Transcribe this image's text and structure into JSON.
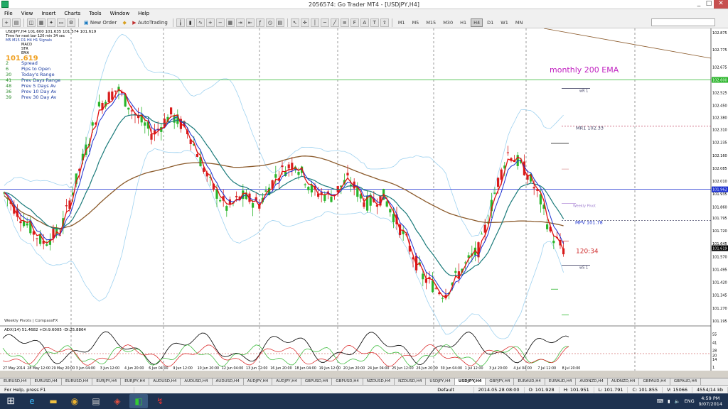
{
  "window": {
    "title": "2056574: Go Trader MT4 - [USDJPY,H4]",
    "min": "_",
    "max": "□",
    "close": "✕"
  },
  "menu": [
    "File",
    "View",
    "Insert",
    "Charts",
    "Tools",
    "Window",
    "Help"
  ],
  "toolbar": {
    "new_order": "New Order",
    "autotrading": "AutoTrading",
    "timeframes": [
      "M1",
      "M5",
      "M15",
      "M30",
      "H1",
      "H4",
      "D1",
      "W1",
      "MN"
    ],
    "active_tf": "H4"
  },
  "chart": {
    "header": "USDJPY,H4  101.600 101.635 101.574 101.619",
    "timer_note": "Time for next bar 120 min 34 sec",
    "tf_row": "M5  M15  D1  H4  H1  Signals",
    "indicators": [
      "MACD",
      "STR",
      "EMA"
    ],
    "big_price": "101.619",
    "stats": [
      {
        "n": "2",
        "l": "Spread"
      },
      {
        "n": "6",
        "l": "Pips to Open"
      },
      {
        "n": "30",
        "l": "Today's Range"
      },
      {
        "n": "41",
        "l": "Prev Days Range"
      },
      {
        "n": "48",
        "l": "Prev 5 Days Av"
      },
      {
        "n": "36",
        "l": "Prev 10 Day Av"
      },
      {
        "n": "39",
        "l": "Prev 30 Day Av"
      }
    ],
    "annotations": {
      "monthly_ema": "monthly 200 EMA",
      "wr1": "wR 1",
      "mr1": "MR1  102.33",
      "weekly_pivot": "Weekly Pivot",
      "mpv": "MPV  101.78",
      "countdown": "120:34",
      "ws1": "wS 1",
      "watermark": "Weekly Pivots | CompassFX"
    },
    "price_axis": [
      "102.875",
      "102.775",
      "102.675",
      "102.525",
      "102.450",
      "102.380",
      "102.310",
      "102.235",
      "102.160",
      "102.085",
      "102.010",
      "101.935",
      "101.860",
      "101.795",
      "101.720",
      "101.645",
      "101.570",
      "101.495",
      "101.420",
      "101.345",
      "101.270",
      "101.195"
    ],
    "current_price": "101.619",
    "line_price": "101.962",
    "green_price": "102.600",
    "adx_header": "ADX(14) 51.4682 +DI:9.6005 -DI:25.8864",
    "adx_axis": [
      "55",
      "41",
      "28",
      "20",
      "14",
      "1"
    ],
    "time_axis": [
      "27 May 2014",
      "28 May 12:00",
      "29 May 20:00",
      "3 Jun 04:00",
      "3 Jun 12:00",
      "4 Jun 20:00",
      "6 Jun 04:00",
      "9 Jun 12:00",
      "10 Jun 20:00",
      "12 Jun 04:00",
      "13 Jun 12:00",
      "16 Jun 20:00",
      "18 Jun 04:00",
      "19 Jun 12:00",
      "20 Jun 20:00",
      "24 Jun 04:00",
      "25 Jun 12:00",
      "26 Jun 20:00",
      "30 Jun 04:00",
      "1 Jul 12:00",
      "3 Jul 20:00",
      "4 Jul 04:00",
      "7 Jul 12:00",
      "8 Jul 20:00"
    ]
  },
  "symbol_tabs": [
    "EURUSD,H4",
    "EURUSD,H4",
    "EURUSD,H4",
    "EURJPY,H4",
    "EURJPY,H4",
    "AUDUSD,H4",
    "AUDUSD,H4",
    "AUDUSD,H4",
    "AUDJPY,H4",
    "AUDJPY,H4",
    "GBPUSD,H4",
    "GBPUSD,H4",
    "NZDUSD,H4",
    "NZDUSD,H4",
    "USDJPY,H4",
    "USDJPY,H4",
    "GBPJPY,H4",
    "EURAUD,H4",
    "EURAUD,H4",
    "AUDNZD,H4",
    "AUDNZD,H4",
    "GBPAUD,H4",
    "GBPAUD,H4"
  ],
  "active_tab_index": 15,
  "status": {
    "help": "For Help, press F1",
    "profile": "Default",
    "datetime": "2014.05.28 08:00",
    "open": "O: 101.928",
    "high": "H: 101.951",
    "low": "L: 101.791",
    "close": "C: 101.855",
    "volume": "V: 15066",
    "traffic": "4554/14 kb"
  },
  "taskbar": {
    "lang": "ENG",
    "time": "4:59 PM",
    "date": "9/07/2014"
  },
  "colors": {
    "bull": "#2ab52a",
    "bear": "#d81c1c",
    "ema_red": "#e01010",
    "ema_blue": "#1a2fd0",
    "ema_teal": "#1a7a7a",
    "ema200": "#8b5a2b",
    "bbands": "#9fd2f0",
    "accent_magenta": "#c020c0"
  }
}
